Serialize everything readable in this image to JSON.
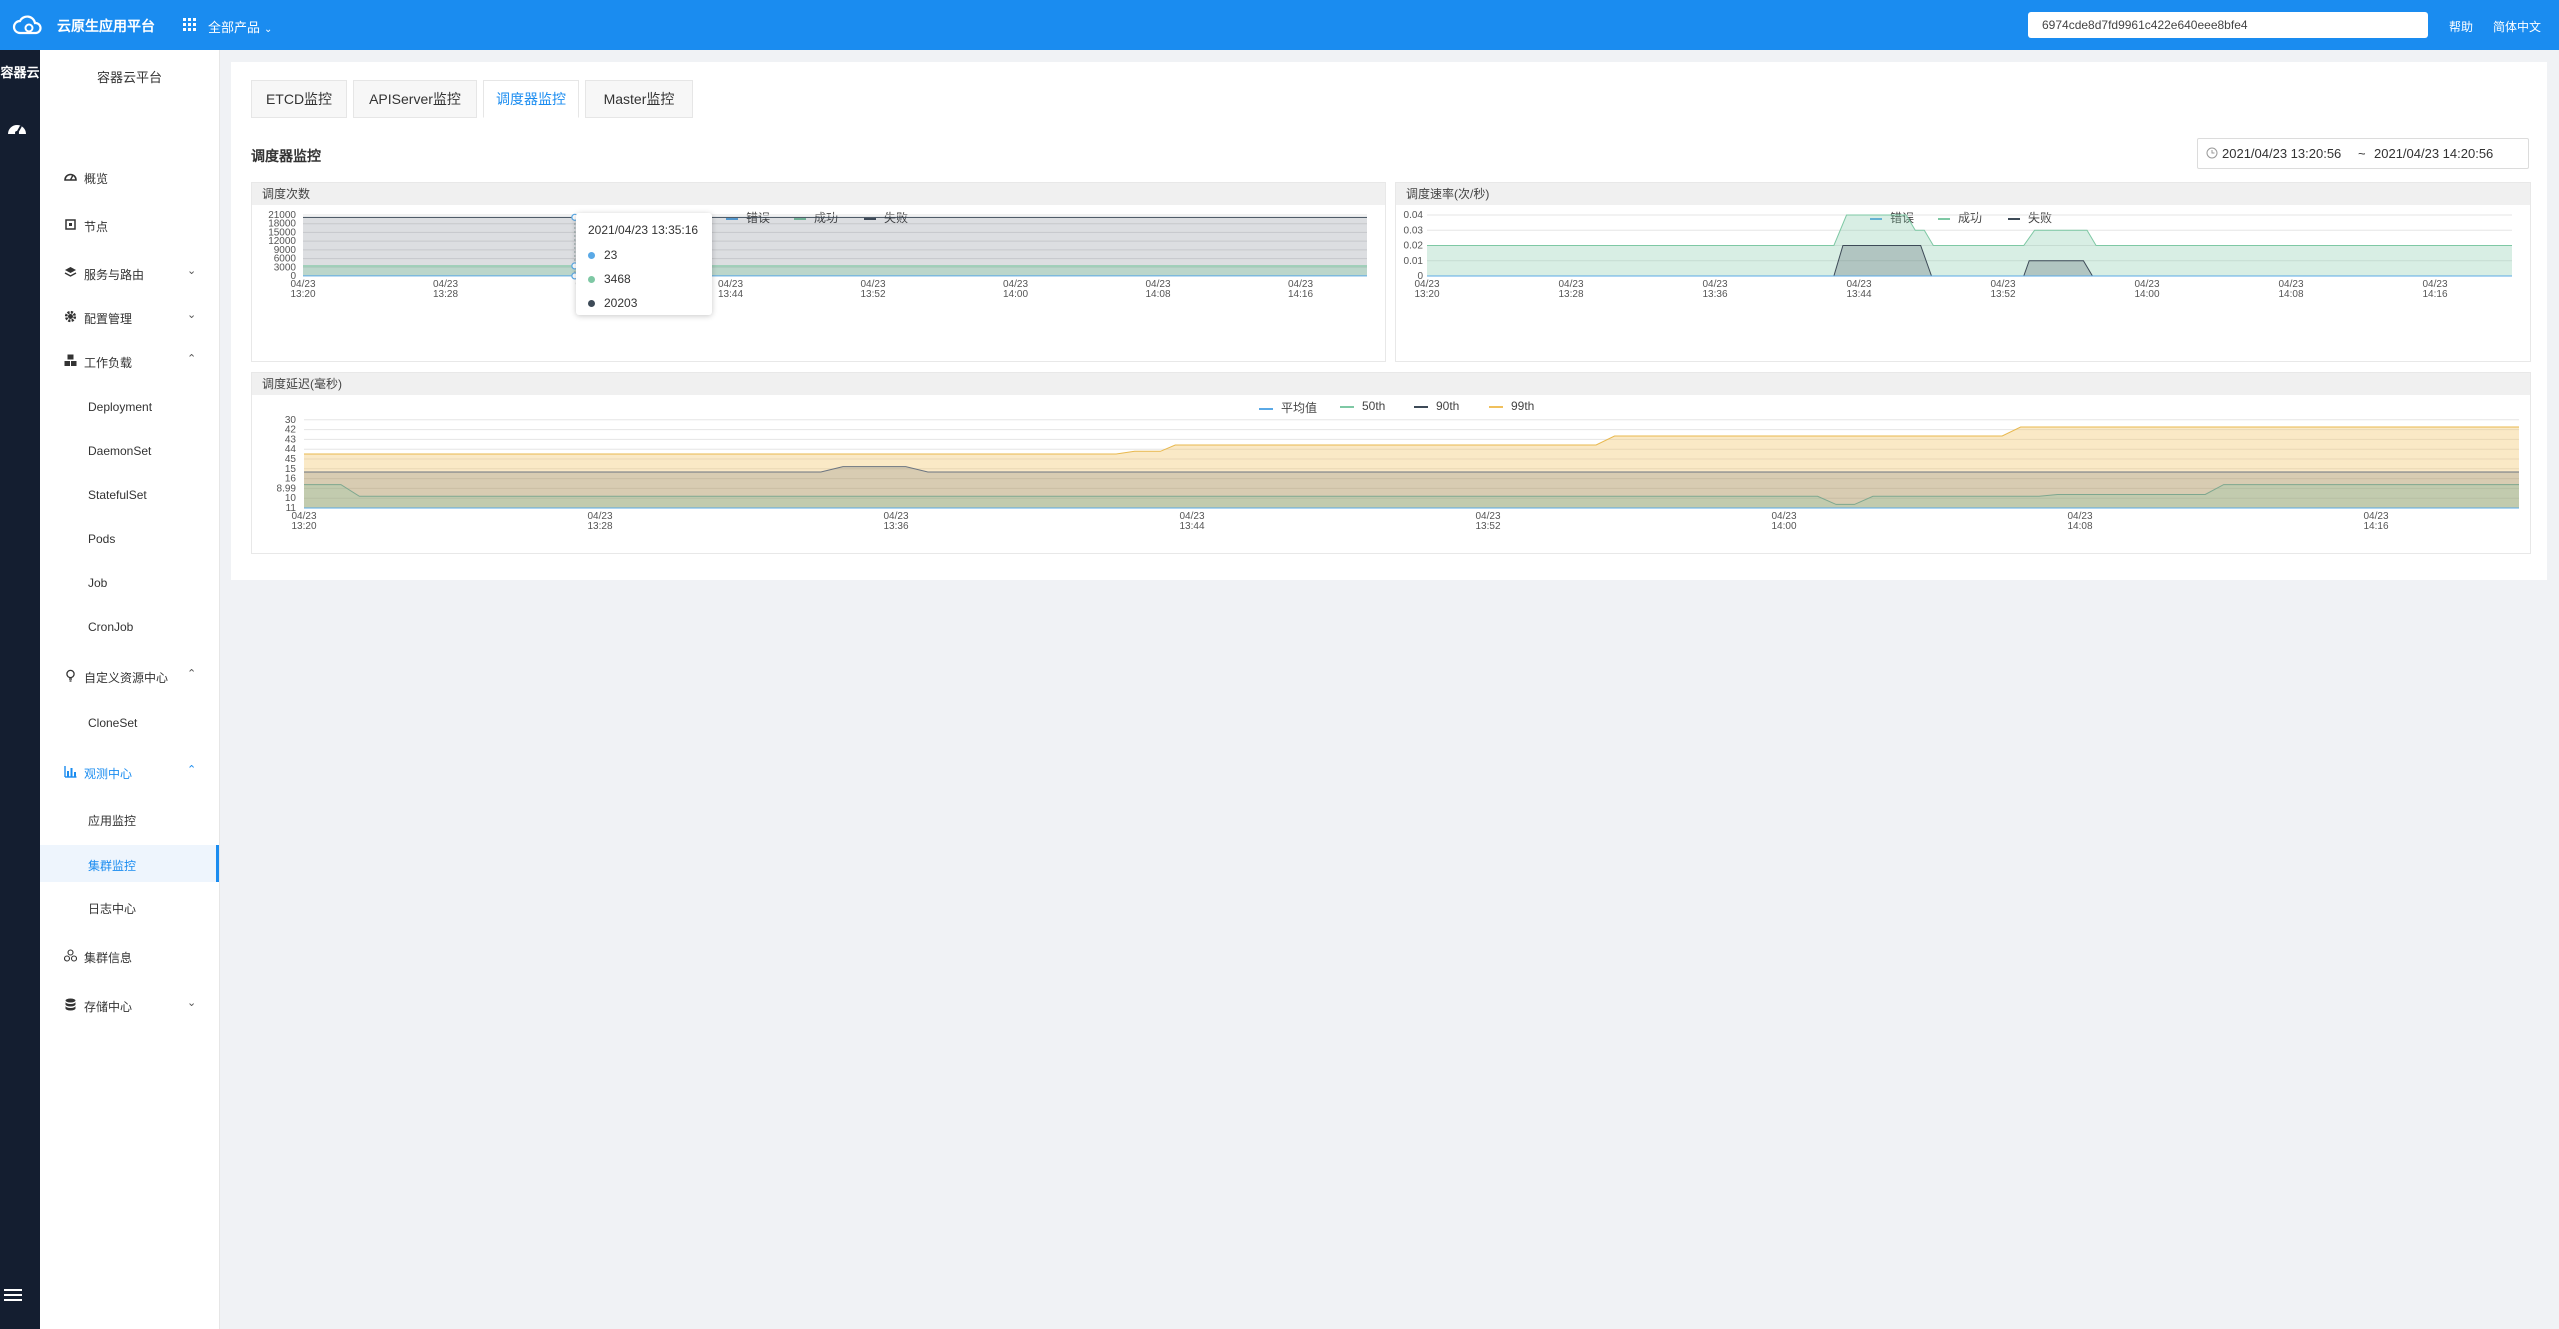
{
  "topbar": {
    "brand": "云原生应用平台",
    "products_label": "全部产品",
    "search_value": "6974cde8d7fd9961c422e640eee8bfe4",
    "help_label": "帮助",
    "lang_label": "简体中文",
    "accent_color": "#1a8cf0"
  },
  "rail": {
    "title": "容器云"
  },
  "sidebar": {
    "title": "容器云平台",
    "items": [
      {
        "label": "概览",
        "icon": "dashboard-icon"
      },
      {
        "label": "节点",
        "icon": "chip-icon"
      },
      {
        "label": "服务与路由",
        "icon": "layers-icon",
        "expandable": true
      },
      {
        "label": "配置管理",
        "icon": "gear-icon",
        "expandable": true
      },
      {
        "label": "工作负载",
        "icon": "cubes-icon",
        "expanded": true
      },
      {
        "label": "Deployment"
      },
      {
        "label": "DaemonSet"
      },
      {
        "label": "StatefulSet"
      },
      {
        "label": "Pods"
      },
      {
        "label": "Job"
      },
      {
        "label": "CronJob"
      },
      {
        "label": "自定义资源中心",
        "icon": "bulb-icon",
        "expanded": true
      },
      {
        "label": "CloneSet"
      },
      {
        "label": "观测中心",
        "icon": "bar-chart-icon",
        "expanded": true,
        "active": true
      },
      {
        "label": "应用监控"
      },
      {
        "label": "集群监控",
        "active": true
      },
      {
        "label": "日志中心"
      },
      {
        "label": "集群信息",
        "icon": "cluster-icon"
      },
      {
        "label": "存储中心",
        "icon": "database-icon",
        "expandable": true
      }
    ]
  },
  "main": {
    "tabs": [
      "ETCD监控",
      "APIServer监控",
      "调度器监控",
      "Master监控"
    ],
    "active_tab": "调度器监控",
    "section_title": "调度器监控",
    "date_range": {
      "start": "2021/04/23 13:20:56",
      "separator": "~",
      "end": "2021/04/23 14:20:56"
    }
  },
  "chart_data": [
    {
      "type": "area",
      "title": "调度次数",
      "legend": [
        "错误",
        "成功",
        "失败"
      ],
      "colors": {
        "错误": "#5aa9e6",
        "成功": "#7ec8a4",
        "失败": "#3d4a57"
      },
      "yticks": [
        "0",
        "3000",
        "6000",
        "9000",
        "12000",
        "15000",
        "18000",
        "21000"
      ],
      "ylim": [
        0,
        21000
      ],
      "xticks": [
        "04/23 13:20",
        "04/23 13:28",
        "04/23 13:36",
        "04/23 13:44",
        "04/23 13:52",
        "04/23 14:00",
        "04/23 14:08",
        "04/23 14:16"
      ],
      "series": [
        {
          "name": "错误",
          "values": [
            23,
            23,
            23,
            23,
            23,
            23,
            23,
            23,
            23
          ]
        },
        {
          "name": "成功",
          "values": [
            3468,
            3468,
            3468,
            3468,
            3468,
            3468,
            3468,
            3468,
            3468
          ]
        },
        {
          "name": "失败",
          "values": [
            20203,
            20203,
            20203,
            20203,
            20203,
            20203,
            20203,
            20203,
            20203
          ]
        }
      ],
      "tooltip": {
        "time": "2021/04/23 13:35:16",
        "values": [
          "23",
          "3468",
          "20203"
        ]
      }
    },
    {
      "type": "area",
      "title": "调度速率(次/秒)",
      "legend": [
        "错误",
        "成功",
        "失败"
      ],
      "yticks": [
        "0",
        "0.01",
        "0.02",
        "0.03",
        "0.04"
      ],
      "ylim": [
        0,
        0.04
      ],
      "xticks": [
        "04/23 13:20",
        "04/23 13:28",
        "04/23 13:36",
        "04/23 13:44",
        "04/23 13:52",
        "04/23 14:00",
        "04/23 14:08",
        "04/23 14:16"
      ],
      "series": [
        {
          "name": "成功",
          "points": [
            [
              0,
              0.02
            ],
            [
              22.5,
              0.02
            ],
            [
              23.2,
              0.04
            ],
            [
              26.5,
              0.04
            ],
            [
              27,
              0.03
            ],
            [
              27.5,
              0.03
            ],
            [
              28,
              0.02
            ],
            [
              33,
              0.02
            ],
            [
              33.6,
              0.03
            ],
            [
              36.5,
              0.03
            ],
            [
              37,
              0.02
            ],
            [
              60,
              0.02
            ]
          ]
        },
        {
          "name": "失败",
          "points": [
            [
              0,
              0
            ],
            [
              22.5,
              0
            ],
            [
              23,
              0.02
            ],
            [
              27.3,
              0.02
            ],
            [
              27.9,
              0
            ],
            [
              33,
              0
            ],
            [
              33.3,
              0.01
            ],
            [
              36.3,
              0.01
            ],
            [
              36.8,
              0
            ],
            [
              60,
              0
            ]
          ]
        }
      ]
    },
    {
      "type": "area",
      "title": "调度延迟(毫秒)",
      "legend": [
        "平均值",
        "50th",
        "90th",
        "99th"
      ],
      "yticks": [
        "11",
        "10",
        "8.99",
        "16",
        "15",
        "45",
        "44",
        "43",
        "42",
        "30"
      ],
      "xticks": [
        "04/23 13:20",
        "04/23 13:28",
        "04/23 13:36",
        "04/23 13:44",
        "04/23 13:52",
        "04/23 14:00",
        "04/23 14:08",
        "04/23 14:16"
      ],
      "series": [
        {
          "name": "99th",
          "points": [
            [
              0,
              6
            ],
            [
              22,
              6
            ],
            [
              22.5,
              6.3
            ],
            [
              23.2,
              6.3
            ],
            [
              23.6,
              7
            ],
            [
              35,
              7
            ],
            [
              35.5,
              8
            ],
            [
              46,
              8
            ],
            [
              46.5,
              9
            ],
            [
              60,
              9
            ]
          ]
        },
        {
          "name": "90th",
          "points": [
            [
              0,
              4
            ],
            [
              14,
              4
            ],
            [
              14.6,
              4.6
            ],
            [
              16.3,
              4.6
            ],
            [
              16.9,
              4
            ],
            [
              60,
              4
            ]
          ]
        },
        {
          "name": "50th",
          "points": [
            [
              0,
              2.6
            ],
            [
              1,
              2.6
            ],
            [
              1.5,
              1.3
            ],
            [
              41,
              1.3
            ],
            [
              41.5,
              0.4
            ],
            [
              42,
              0.4
            ],
            [
              42.5,
              1.3
            ],
            [
              47,
              1.3
            ],
            [
              47.5,
              1.5
            ],
            [
              51.5,
              1.5
            ],
            [
              52,
              2.6
            ],
            [
              60,
              2.6
            ]
          ]
        },
        {
          "name": "平均值",
          "points": [
            [
              0,
              0
            ],
            [
              60,
              0
            ]
          ]
        }
      ]
    }
  ]
}
